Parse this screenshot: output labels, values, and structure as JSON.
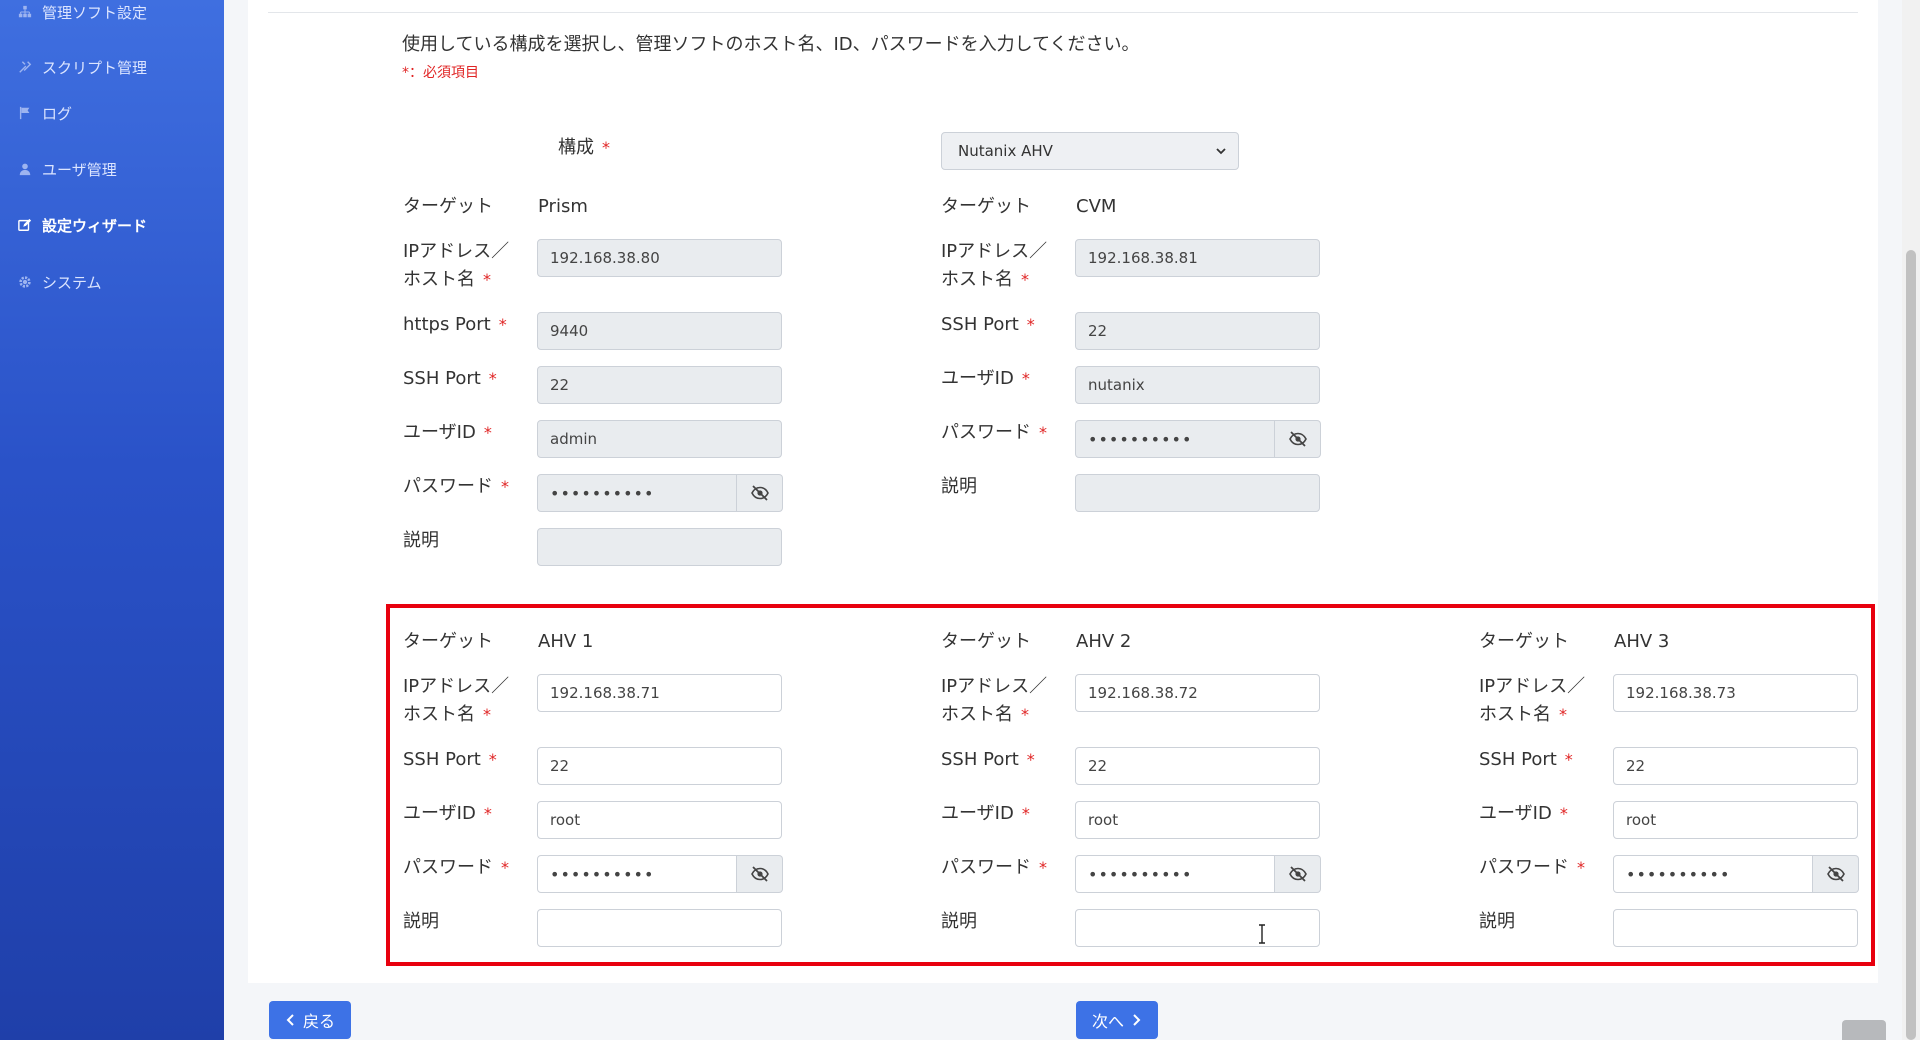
{
  "sidebar": {
    "items": [
      {
        "label": "管理ソフト設定",
        "icon": "sitemap-icon"
      },
      {
        "label": "スクリプト管理",
        "icon": "tools-icon"
      },
      {
        "label": "ログ",
        "icon": "flag-icon"
      },
      {
        "label": "ユーザ管理",
        "icon": "user-icon"
      },
      {
        "label": "設定ウィザード",
        "icon": "edit-icon",
        "active": true
      },
      {
        "label": "システム",
        "icon": "gear-icon"
      }
    ]
  },
  "form": {
    "intro": "使用している構成を選択し、管理ソフトのホスト名、ID、パスワードを入力してください。",
    "required_note": "*：必須項目",
    "config_label": "構成",
    "required_mark": "*",
    "config_value": "Nutanix AHV",
    "labels": {
      "target": "ターゲット",
      "ip_line1": "IPアドレス／",
      "ip_line2": "ホスト名",
      "https_port": "https Port",
      "ssh_port": "SSH Port",
      "user_id": "ユーザID",
      "password": "パスワード",
      "description": "説明"
    },
    "prism": {
      "target": "Prism",
      "ip": "192.168.38.80",
      "https_port": "9440",
      "ssh_port": "22",
      "user": "admin",
      "password": "••••••••••",
      "description": ""
    },
    "cvm": {
      "target": "CVM",
      "ip": "192.168.38.81",
      "ssh_port": "22",
      "user": "nutanix",
      "password": "••••••••••",
      "description": ""
    },
    "ahv1": {
      "target": "AHV 1",
      "ip": "192.168.38.71",
      "ssh_port": "22",
      "user": "root",
      "password": "••••••••••",
      "description": ""
    },
    "ahv2": {
      "target": "AHV 2",
      "ip": "192.168.38.72",
      "ssh_port": "22",
      "user": "root",
      "password": "••••••••••",
      "description": ""
    },
    "ahv3": {
      "target": "AHV 3",
      "ip": "192.168.38.73",
      "ssh_port": "22",
      "user": "root",
      "password": "••••••••••",
      "description": ""
    }
  },
  "buttons": {
    "back": "戻る",
    "next": "次へ"
  },
  "colors": {
    "accent": "#3d72e6",
    "required": "#e02424",
    "highlight": "#e8000e"
  }
}
